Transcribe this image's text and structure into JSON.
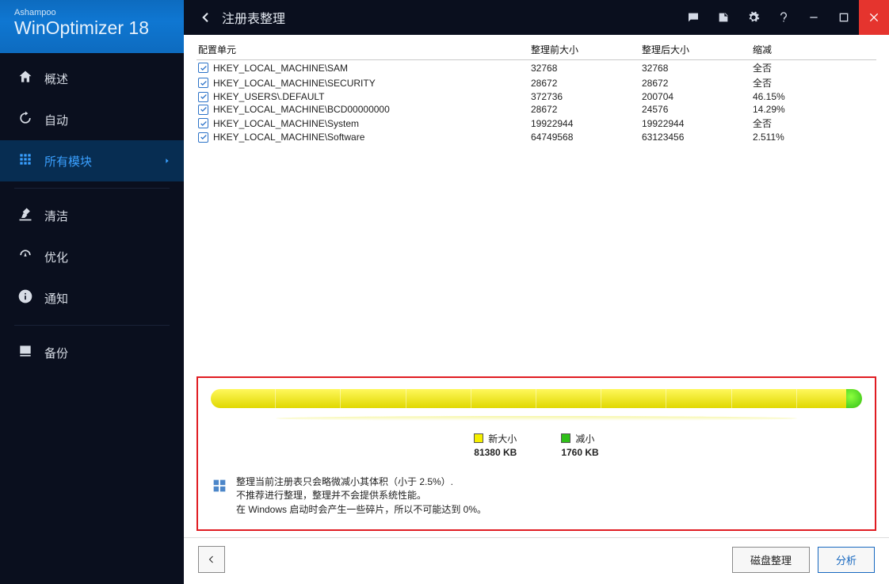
{
  "brand": {
    "top": "Ashampoo",
    "name": "WinOptimizer ",
    "version": "18"
  },
  "sidebar": {
    "items": [
      {
        "label": "概述"
      },
      {
        "label": "自动"
      },
      {
        "label": "所有模块"
      },
      {
        "label": "清洁"
      },
      {
        "label": "优化"
      },
      {
        "label": "通知"
      },
      {
        "label": "备份"
      }
    ]
  },
  "header": {
    "title": "注册表整理"
  },
  "table": {
    "columns": [
      "配置单元",
      "整理前大小",
      "整理后大小",
      "缩减"
    ],
    "rows": [
      {
        "name": "HKEY_LOCAL_MACHINE\\SAM",
        "before": "32768",
        "after": "32768",
        "reduction": "全否"
      },
      {
        "name": "HKEY_LOCAL_MACHINE\\SECURITY",
        "before": "28672",
        "after": "28672",
        "reduction": "全否"
      },
      {
        "name": "HKEY_USERS\\.DEFAULT",
        "before": "372736",
        "after": "200704",
        "reduction": "46.15%"
      },
      {
        "name": "HKEY_LOCAL_MACHINE\\BCD00000000",
        "before": "28672",
        "after": "24576",
        "reduction": "14.29%"
      },
      {
        "name": "HKEY_LOCAL_MACHINE\\System",
        "before": "19922944",
        "after": "19922944",
        "reduction": "全否"
      },
      {
        "name": "HKEY_LOCAL_MACHINE\\Software",
        "before": "64749568",
        "after": "63123456",
        "reduction": "2.511%"
      }
    ]
  },
  "legend": {
    "new_size": {
      "label": "新大小",
      "value": "81380 KB"
    },
    "reduce": {
      "label": "减小",
      "value": "1760 KB"
    }
  },
  "notes": {
    "line1": "整理当前注册表只会略微减小其体积（小于 2.5%）.",
    "line2": "不推荐进行整理，整理并不会提供系统性能。",
    "line3": "在 Windows 启动时会产生一些碎片，所以不可能达到 0%。"
  },
  "footer": {
    "defrag": "磁盘整理",
    "analyze": "分析"
  },
  "chart_data": {
    "type": "bar",
    "title": "Registry size after defrag",
    "series": [
      {
        "name": "新大小",
        "color": "#f5ef00",
        "value_kb": 81380
      },
      {
        "name": "减小",
        "color": "#2fbf18",
        "value_kb": 1760
      }
    ],
    "total_kb": 83140
  }
}
